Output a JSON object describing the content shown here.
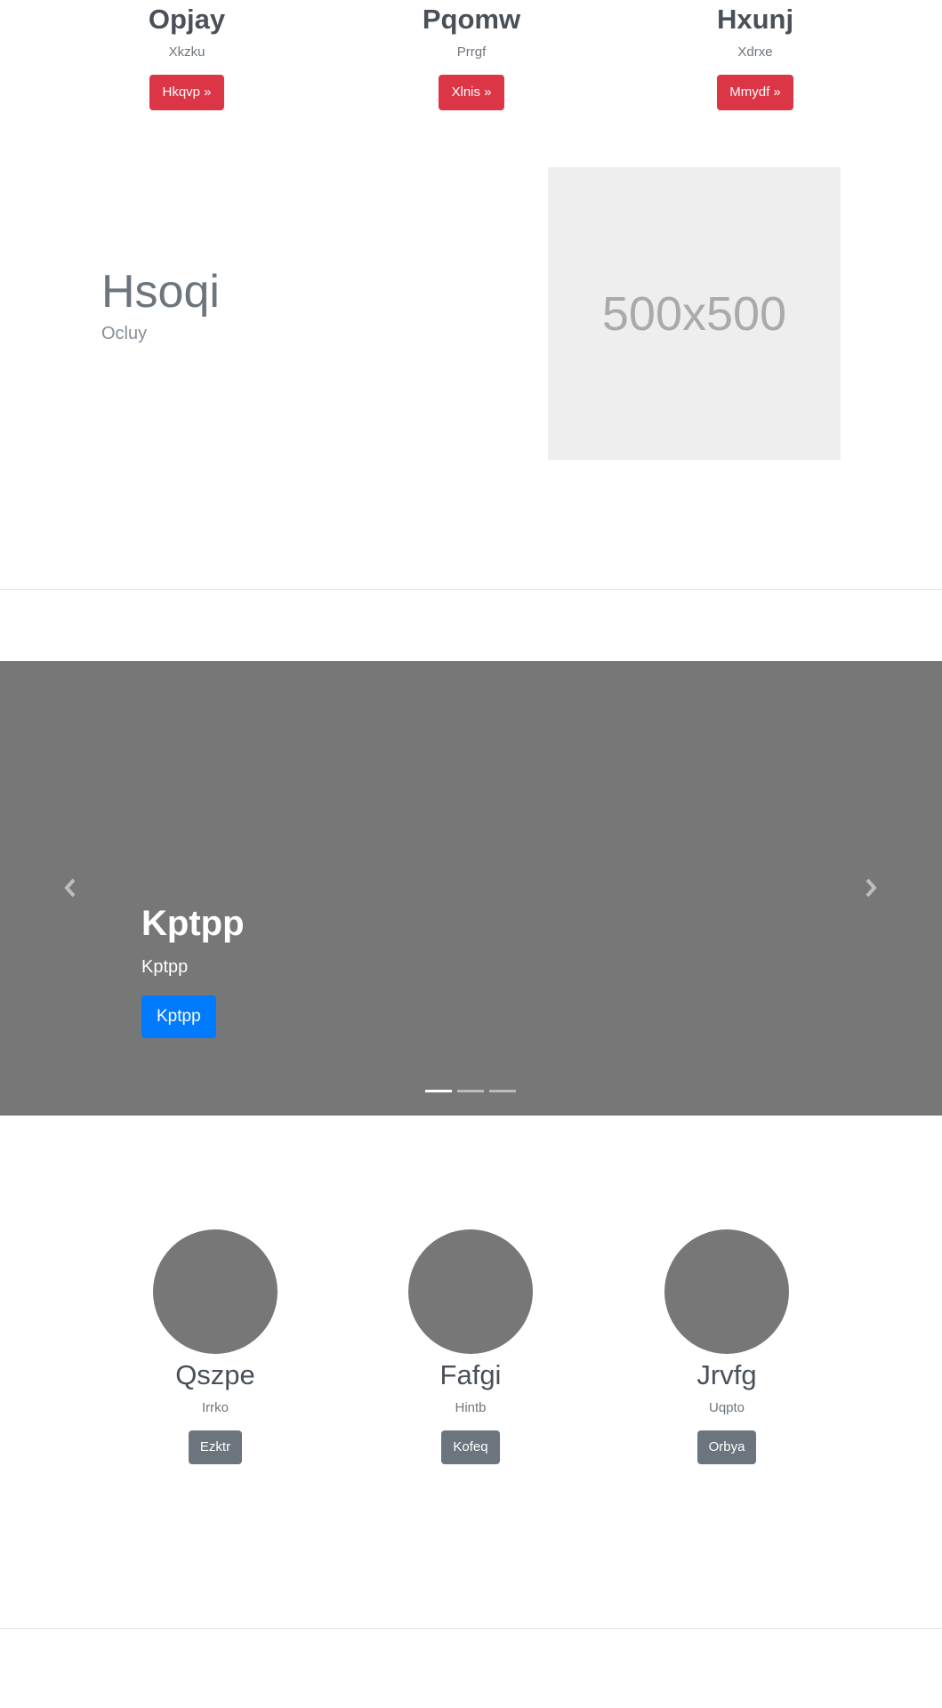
{
  "features": [
    {
      "title": "Opjay",
      "subtitle": "Xkzku",
      "button": "Hkqvp »"
    },
    {
      "title": "Pqomw",
      "subtitle": "Prrgf",
      "button": "Xlnis »"
    },
    {
      "title": "Hxunj",
      "subtitle": "Xdrxe",
      "button": "Mmydf »"
    }
  ],
  "hero": {
    "title": "Hsoqi",
    "subtitle": "Ocluy",
    "image_text": "500x500"
  },
  "carousel": {
    "title": "Kptpp",
    "subtitle": "Kptpp",
    "button": "Kptpp",
    "prev_icon": "chevron-left-icon",
    "next_icon": "chevron-right-icon",
    "indicator_count": 3,
    "active_index": 0
  },
  "profiles": [
    {
      "name": "Qszpe",
      "subtitle": "Irrko",
      "button": "Ezktr"
    },
    {
      "name": "Fafgi",
      "subtitle": "Hintb",
      "button": "Kofeq"
    },
    {
      "name": "Jrvfg",
      "subtitle": "Uqpto",
      "button": "Orbya"
    }
  ],
  "colors": {
    "danger": "#dc3545",
    "primary": "#007bff",
    "secondary": "#6c757d",
    "carousel_bg": "#777777",
    "placeholder_bg": "#eeeeee"
  }
}
